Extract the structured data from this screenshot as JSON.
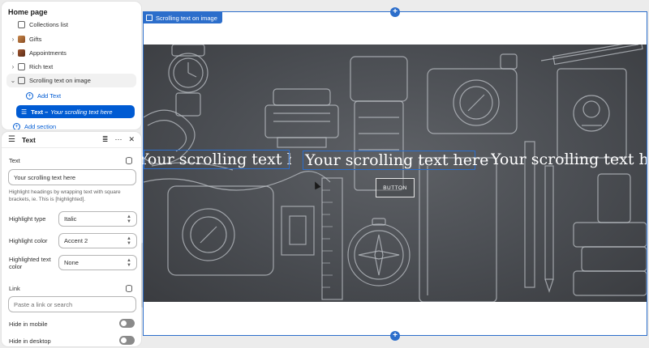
{
  "nav": {
    "title": "Home page",
    "items": [
      {
        "label": "Collections list",
        "icon": "collection-list-icon"
      },
      {
        "label": "Gifts",
        "icon": "image-thumbnail-icon"
      },
      {
        "label": "Appointments",
        "icon": "image-thumbnail-icon"
      },
      {
        "label": "Rich text",
        "icon": "text-block-icon"
      },
      {
        "label": "Scrolling text on image",
        "icon": "text-block-icon"
      }
    ],
    "add_text": "Add Text",
    "selected_block": {
      "prefix": "Text –",
      "name": "Your scrolling text here"
    },
    "add_section": "Add section"
  },
  "settings": {
    "title": "Text",
    "text_label": "Text",
    "text_value": "Your scrolling text here",
    "help": "Highlight headings by wrapping text with square brackets, ie. This is [highlighted].",
    "highlight_type_label": "Highlight type",
    "highlight_type_value": "Italic",
    "highlight_color_label": "Highlight color",
    "highlight_color_value": "Accent 2",
    "highlighted_text_color_label": "Highlighted text color",
    "highlighted_text_color_value": "None",
    "link_label": "Link",
    "link_placeholder": "Paste a link or search",
    "hide_mobile_label": "Hide in mobile",
    "hide_desktop_label": "Hide in desktop"
  },
  "preview": {
    "section_tag": "Scrolling text on image",
    "scroll_text": "Your scrolling text here",
    "button_label": "BUTTON"
  },
  "colors": {
    "accent": "#2c6ecb",
    "selected": "#005bd3",
    "hero_bg": "#4a4d52"
  }
}
